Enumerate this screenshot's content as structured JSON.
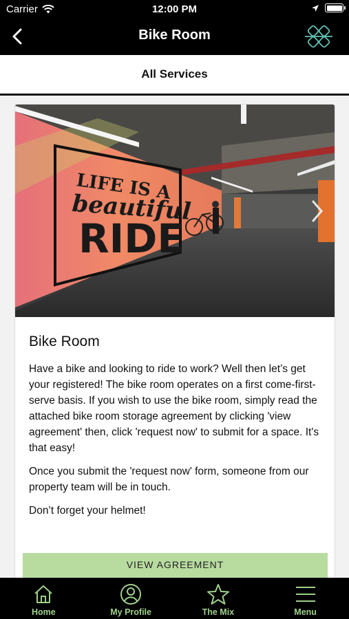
{
  "status_bar": {
    "carrier": "Carrier",
    "time": "12:00 PM"
  },
  "nav": {
    "title": "Bike Room"
  },
  "subheader": {
    "label": "All Services"
  },
  "card": {
    "mural_text": {
      "line1": "LIFE IS A",
      "line2": "beautiful",
      "line3": "RIDE"
    },
    "title": "Bike Room",
    "paragraphs": [
      "Have a bike and looking to ride to work? Well then let’s get your registered! The bike room operates on a first come-first-serve basis. If you wish to use the bike room, simply read the attached bike room storage agreement by clicking 'view agreement' then, click 'request now' to submit for a space. It's that easy!",
      "Once you submit the 'request now' form, someone from our property team will be in touch.",
      "Don’t forget your helmet!"
    ],
    "button_label": "VIEW AGREEMENT"
  },
  "tabs": [
    {
      "label": "Home",
      "icon": "home-icon"
    },
    {
      "label": "My Profile",
      "icon": "profile-icon"
    },
    {
      "label": "The Mix",
      "icon": "star-icon"
    },
    {
      "label": "Menu",
      "icon": "menu-icon"
    }
  ],
  "colors": {
    "accent_green": "#9fd08a",
    "button_green": "#b8dba0",
    "logo_teal": "#5fc0b5"
  }
}
